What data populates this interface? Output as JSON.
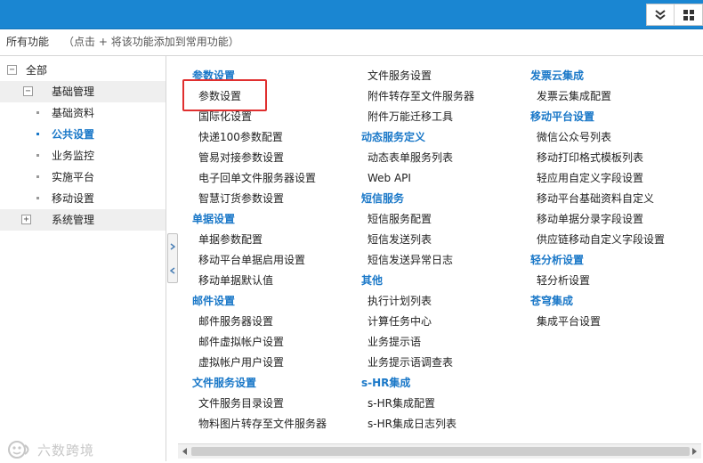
{
  "header": {
    "collapse_icon": "double-chevron-down-icon",
    "grid_icon": "grid-icon"
  },
  "title": {
    "label": "所有功能",
    "hint": "（点击 + 将该功能添加到常用功能）"
  },
  "tree": {
    "items": [
      {
        "label": "全部",
        "toggle": "⊟"
      },
      {
        "label": "基础管理",
        "toggle": "⊟"
      },
      {
        "label": "基础资料"
      },
      {
        "label": "公共设置"
      },
      {
        "label": "业务监控"
      },
      {
        "label": "实施平台"
      },
      {
        "label": "移动设置"
      },
      {
        "label": "系统管理",
        "toggle": "⊞"
      }
    ]
  },
  "columns": {
    "col1": [
      {
        "type": "head",
        "text": "参数设置"
      },
      {
        "type": "link",
        "text": "参数设置"
      },
      {
        "type": "link",
        "text": "国际化设置"
      },
      {
        "type": "link",
        "text": "快递100参数配置"
      },
      {
        "type": "link",
        "text": "管易对接参数设置"
      },
      {
        "type": "link",
        "text": "电子回单文件服务器设置"
      },
      {
        "type": "link",
        "text": "智慧订货参数设置"
      },
      {
        "type": "head",
        "text": "单据设置"
      },
      {
        "type": "link",
        "text": "单据参数配置"
      },
      {
        "type": "link",
        "text": "移动平台单据启用设置"
      },
      {
        "type": "link",
        "text": "移动单据默认值"
      },
      {
        "type": "head",
        "text": "邮件设置"
      },
      {
        "type": "link",
        "text": "邮件服务器设置"
      },
      {
        "type": "link",
        "text": "邮件虚拟帐户设置"
      },
      {
        "type": "link",
        "text": "虚拟帐户用户设置"
      },
      {
        "type": "head",
        "text": "文件服务设置"
      },
      {
        "type": "link",
        "text": "文件服务目录设置"
      },
      {
        "type": "link",
        "text": "物料图片转存至文件服务器"
      }
    ],
    "col2": [
      {
        "type": "link",
        "text": "文件服务设置"
      },
      {
        "type": "link",
        "text": "附件转存至文件服务器"
      },
      {
        "type": "link",
        "text": "附件万能迁移工具"
      },
      {
        "type": "head",
        "text": "动态服务定义"
      },
      {
        "type": "link",
        "text": "动态表单服务列表"
      },
      {
        "type": "link",
        "text": "Web API"
      },
      {
        "type": "head",
        "text": "短信服务"
      },
      {
        "type": "link",
        "text": "短信服务配置"
      },
      {
        "type": "link",
        "text": "短信发送列表"
      },
      {
        "type": "link",
        "text": "短信发送异常日志"
      },
      {
        "type": "head",
        "text": "其他"
      },
      {
        "type": "link",
        "text": "执行计划列表"
      },
      {
        "type": "link",
        "text": "计算任务中心"
      },
      {
        "type": "link",
        "text": "业务提示语"
      },
      {
        "type": "link",
        "text": "业务提示语调查表"
      },
      {
        "type": "head",
        "text": "s-HR集成"
      },
      {
        "type": "link",
        "text": "s-HR集成配置"
      },
      {
        "type": "link",
        "text": "s-HR集成日志列表"
      }
    ],
    "col3": [
      {
        "type": "head",
        "text": "发票云集成"
      },
      {
        "type": "link",
        "text": "发票云集成配置"
      },
      {
        "type": "head",
        "text": "移动平台设置"
      },
      {
        "type": "link",
        "text": "微信公众号列表"
      },
      {
        "type": "link",
        "text": "移动打印格式模板列表"
      },
      {
        "type": "link",
        "text": "轻应用自定义字段设置"
      },
      {
        "type": "link",
        "text": "移动平台基础资料自定义"
      },
      {
        "type": "link",
        "text": "移动单据分录字段设置"
      },
      {
        "type": "link",
        "text": "供应链移动自定义字段设置"
      },
      {
        "type": "head",
        "text": "轻分析设置"
      },
      {
        "type": "link",
        "text": "轻分析设置"
      },
      {
        "type": "head",
        "text": "苍穹集成"
      },
      {
        "type": "link",
        "text": "集成平台设置"
      }
    ]
  },
  "watermark": {
    "logo_icon": "watermark-logo-icon",
    "text": "六数跨境"
  },
  "colors": {
    "header_blue": "#1a86d2",
    "section_blue": "#1a78c8",
    "highlight_red": "#e02f2f"
  }
}
